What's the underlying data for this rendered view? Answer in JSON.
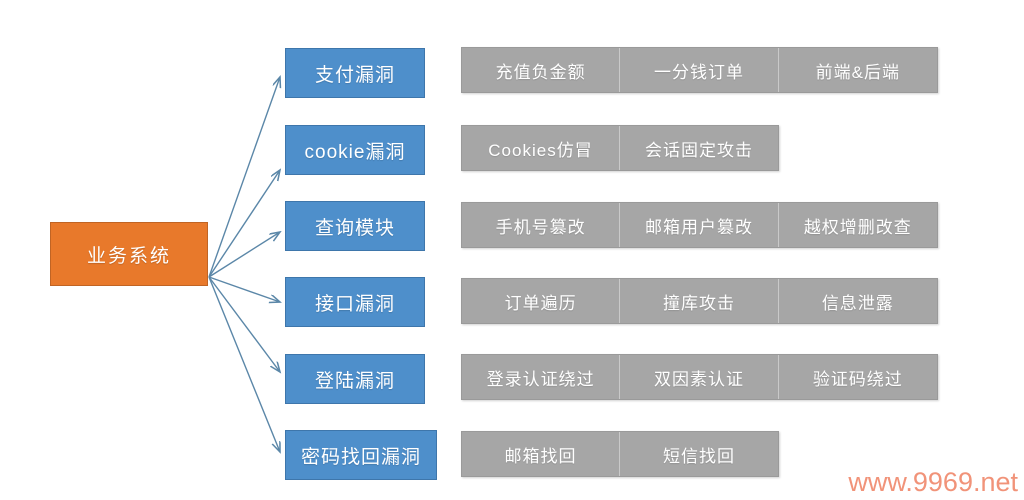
{
  "diagram": {
    "title_node": {
      "label": "业务系统",
      "color": "#E8792B"
    },
    "category_color": "#4E8FCB",
    "detail_color": "#A6A6A6",
    "connector_color": "#5B87A8",
    "branches": [
      {
        "category": "支付漏洞",
        "details": [
          "充值负金额",
          "一分钱订单",
          "前端&后端"
        ]
      },
      {
        "category": "cookie漏洞",
        "details": [
          "Cookies仿冒",
          "会话固定攻击"
        ]
      },
      {
        "category": "查询模块",
        "details": [
          "手机号篡改",
          "邮箱用户篡改",
          "越权增删改查"
        ]
      },
      {
        "category": "接口漏洞",
        "details": [
          "订单遍历",
          "撞库攻击",
          "信息泄露"
        ]
      },
      {
        "category": "登陆漏洞",
        "details": [
          "登录认证绕过",
          "双因素认证",
          "验证码绕过"
        ]
      },
      {
        "category": "密码找回漏洞",
        "details": [
          "邮箱找回",
          "短信找回"
        ]
      }
    ]
  },
  "watermark": {
    "text": "www.9969.net",
    "color": "#F08A6E"
  }
}
